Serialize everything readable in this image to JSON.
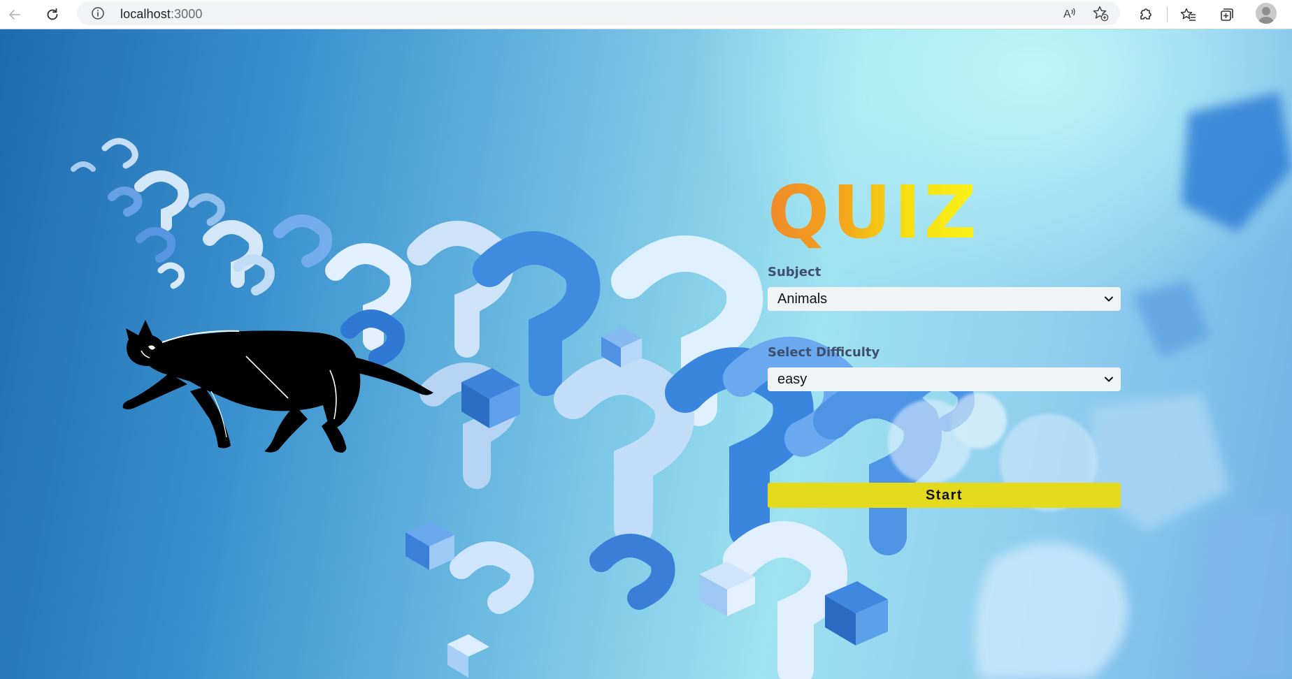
{
  "browser": {
    "url_host": "localhost",
    "url_port": ":3000",
    "icons": {
      "back": "back-arrow-icon",
      "reload": "reload-icon",
      "site_info": "info-icon",
      "read_aloud": "read-aloud-icon",
      "favorite": "add-favorite-icon",
      "extensions": "extensions-icon",
      "favorites": "favorites-icon",
      "collections": "collections-icon",
      "profile": "profile-avatar-icon"
    }
  },
  "quiz": {
    "title": "QUIZ",
    "subject_label": "Subject",
    "subject_value": "Animals",
    "difficulty_label": "Select Difficulty",
    "difficulty_value": "easy",
    "start_label": "Start"
  },
  "colors": {
    "title_gradient_start": "#ef8a2a",
    "title_gradient_end": "#fbf11a",
    "start_button": "#e3d91d",
    "label_text": "#3e4f6f",
    "select_background": "#f0f4f7"
  },
  "illustration": {
    "mascot": "black-cat"
  }
}
